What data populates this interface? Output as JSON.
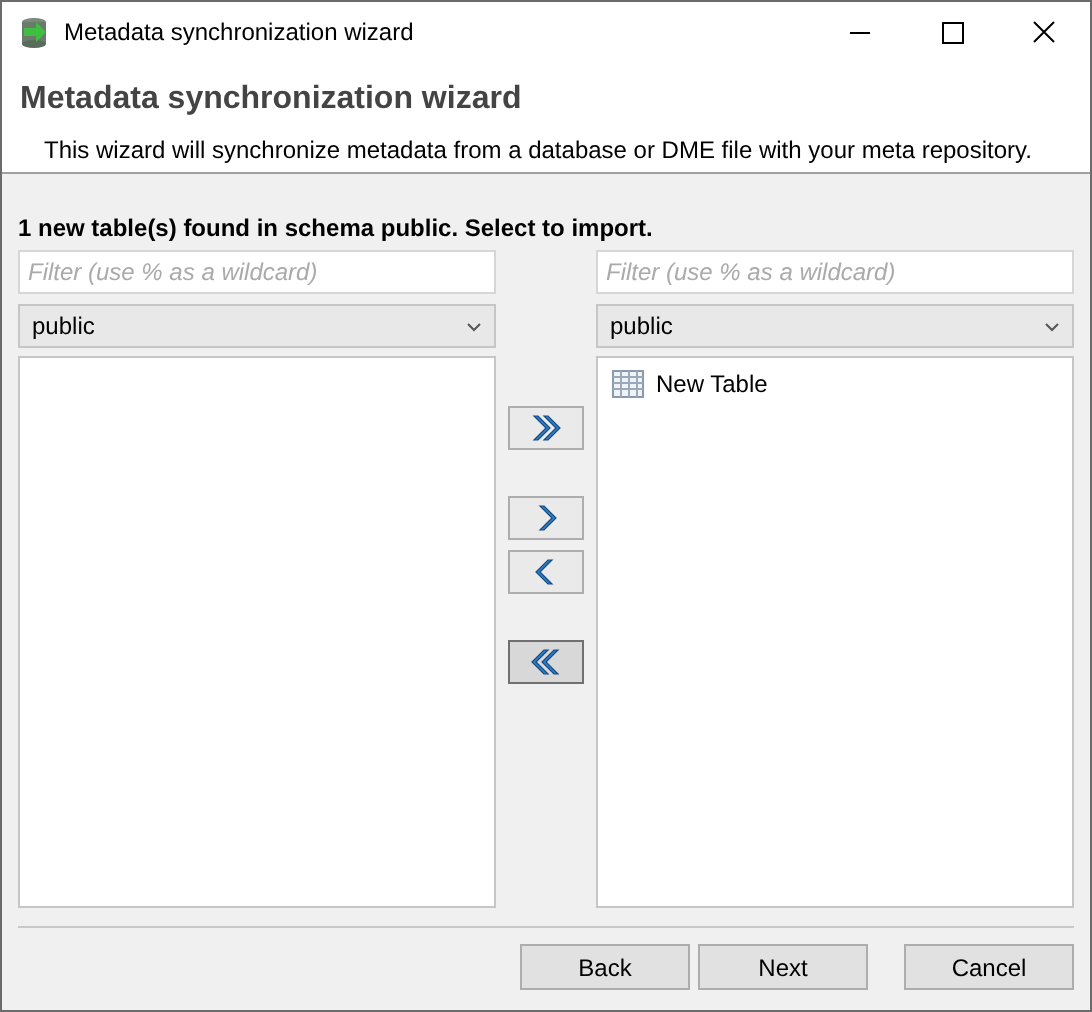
{
  "window": {
    "title": "Metadata synchronization wizard"
  },
  "header": {
    "title": "Metadata synchronization wizard",
    "description": "This wizard will synchronize metadata from a database or DME file with your meta repository."
  },
  "message": "1 new table(s) found in schema public. Select to import.",
  "source": {
    "filter": {
      "placeholder": "Filter (use % as a wildcard)"
    },
    "schema": "public"
  },
  "target": {
    "filter": {
      "placeholder": "Filter (use % as a wildcard)"
    },
    "schema": "public",
    "items": [
      {
        "label": "New Table"
      }
    ]
  },
  "move_buttons": [
    {
      "kind": "add-all",
      "focused": false
    },
    {
      "kind": "add",
      "focused": false
    },
    {
      "kind": "remove",
      "focused": false
    },
    {
      "kind": "remove-all",
      "focused": true
    }
  ],
  "buttons": [
    {
      "label": "Back"
    },
    {
      "label": "Next"
    },
    {
      "label": "Cancel"
    }
  ]
}
